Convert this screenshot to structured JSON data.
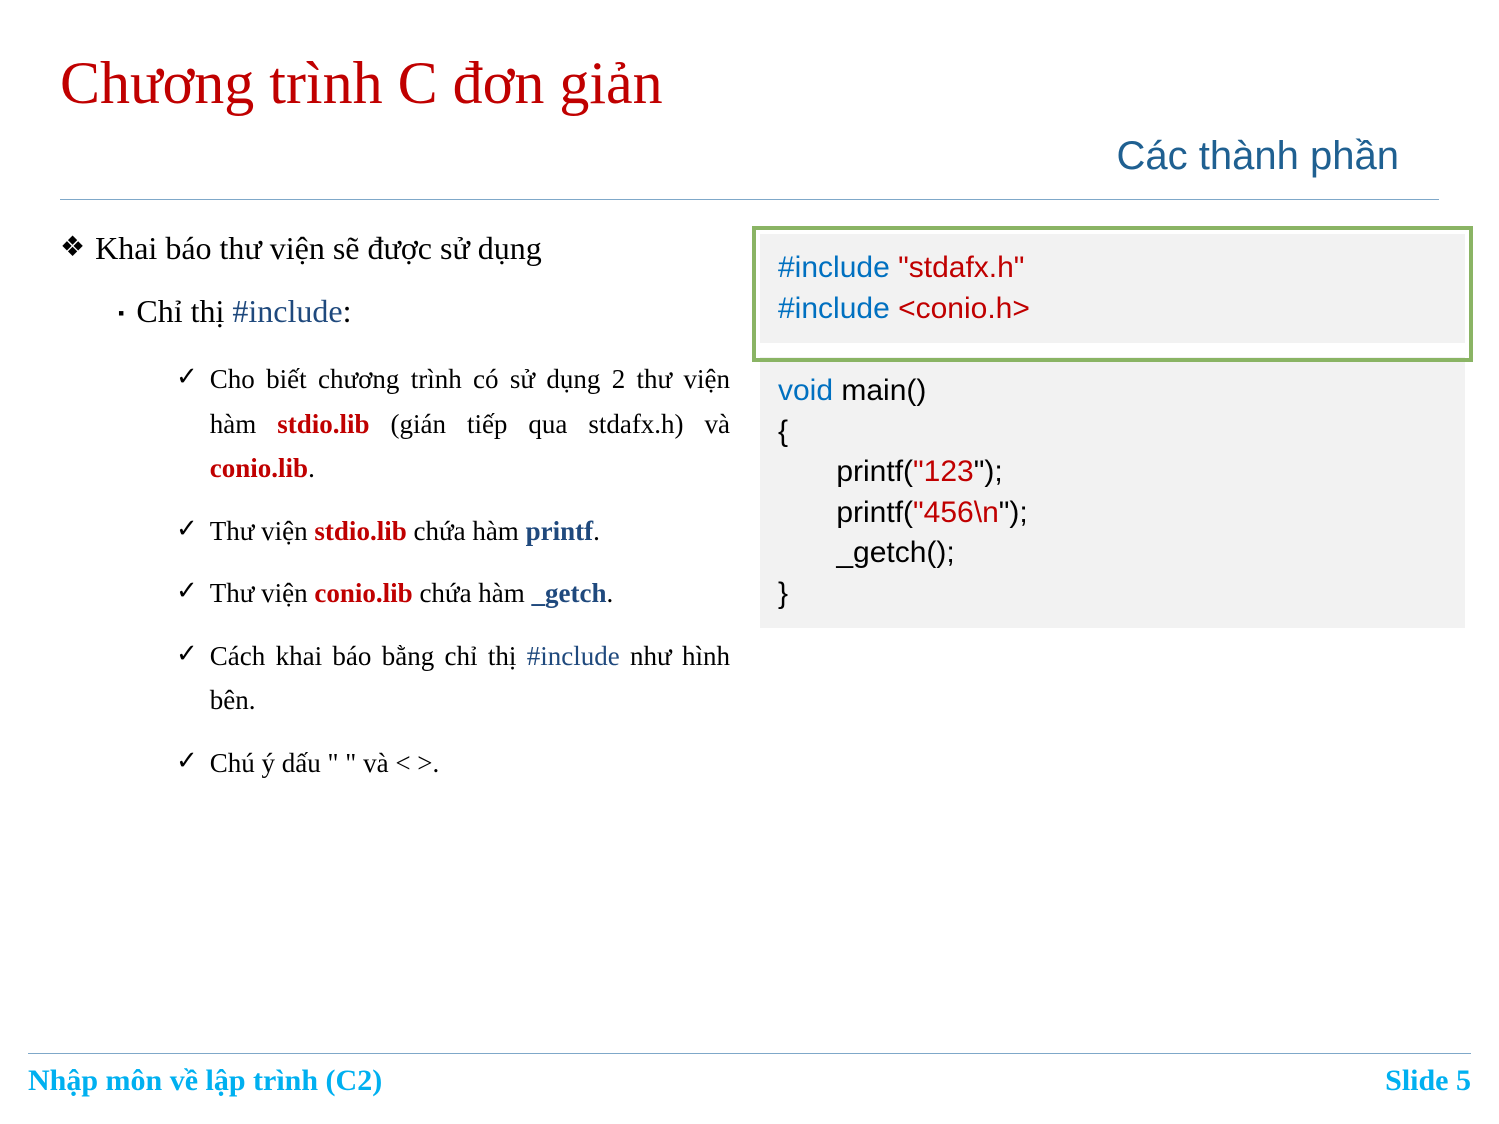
{
  "title": "Chương trình C đơn giản",
  "subtitle": "Các thành phần",
  "main_bullet": "Khai báo thư viện sẽ được sử dụng",
  "sub_bullet_prefix": "Chỉ thị ",
  "sub_bullet_keyword": "#include",
  "sub_bullet_suffix": ":",
  "checks": {
    "c1_p1": "Cho biết chương trình có sử dụng 2 thư viện hàm ",
    "c1_kw1": "stdio.lib",
    "c1_p2": " (gián tiếp qua stdafx.h) và ",
    "c1_kw2": "conio.lib",
    "c1_p3": ".",
    "c2_p1": "Thư viện ",
    "c2_kw1": "stdio.lib",
    "c2_p2": " chứa hàm ",
    "c2_kw2": "printf",
    "c2_p3": ".",
    "c3_p1": "Thư viện ",
    "c3_kw1": "conio.lib",
    "c3_p2": " chứa hàm ",
    "c3_kw2": "_getch",
    "c3_p3": ".",
    "c4_p1": "Cách khai báo bằng chỉ thị ",
    "c4_kw1": "#include",
    "c4_p2": " như hình bên.",
    "c5": "Chú ý dấu \" \" và < >."
  },
  "code": {
    "l1a": "#include ",
    "l1b": "\"stdafx.h\"",
    "l2a": "#include ",
    "l2b": "<conio.h>",
    "l3a": "void",
    "l3b": " main()",
    "l4": "{",
    "l5a": "       printf(",
    "l5b": "\"123",
    "l5c": "\");",
    "l6a": "       printf(",
    "l6b": "\"456\\n",
    "l6c": "\");",
    "l7": "       _getch();",
    "l8": "}"
  },
  "footer_left": "Nhập môn về lập trình (C2)",
  "footer_right": "Slide 5"
}
